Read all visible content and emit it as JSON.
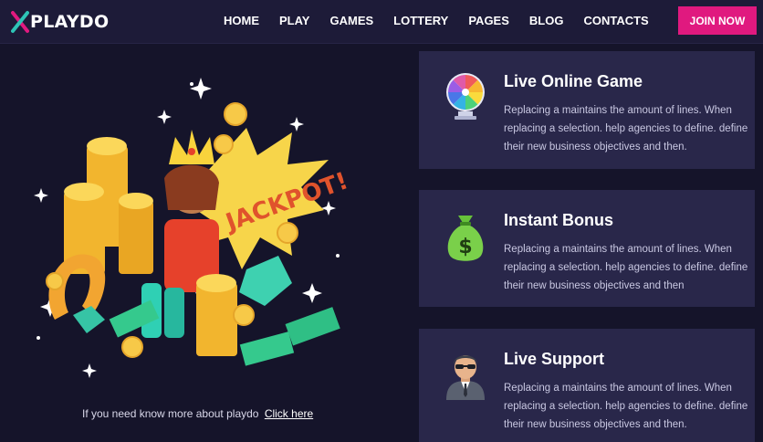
{
  "brand": {
    "x": "X",
    "name": "PLAYDO"
  },
  "nav": {
    "items": [
      "HOME",
      "PLAY",
      "GAMES",
      "LOTTERY",
      "PAGES",
      "BLOG",
      "CONTACTS"
    ],
    "cta": "JOIN NOW"
  },
  "colors": {
    "accent": "#e0197f",
    "background": "#15142a",
    "header": "#1d1b38",
    "card": "#29274a",
    "gold": "#f7c948"
  },
  "illustration": {
    "banner_text": "JACKPOT!",
    "icon": "jackpot-illustration"
  },
  "more_info": {
    "text": "If you need know more about playdo",
    "link": "Click here"
  },
  "features": [
    {
      "icon": "prize-wheel-icon",
      "title": "Live Online Game",
      "text": "Replacing a maintains the amount of lines. When replacing a selection. help agencies to define. define their new business objectives and then."
    },
    {
      "icon": "money-bag-icon",
      "title": "Instant Bonus",
      "text": "Replacing a maintains the amount of lines. When replacing a selection. help agencies to define. define their new business objectives and then"
    },
    {
      "icon": "support-agent-icon",
      "title": "Live Support",
      "text": "Replacing a maintains the amount of lines. When replacing a selection. help agencies to define. define their new business objectives and then."
    }
  ]
}
